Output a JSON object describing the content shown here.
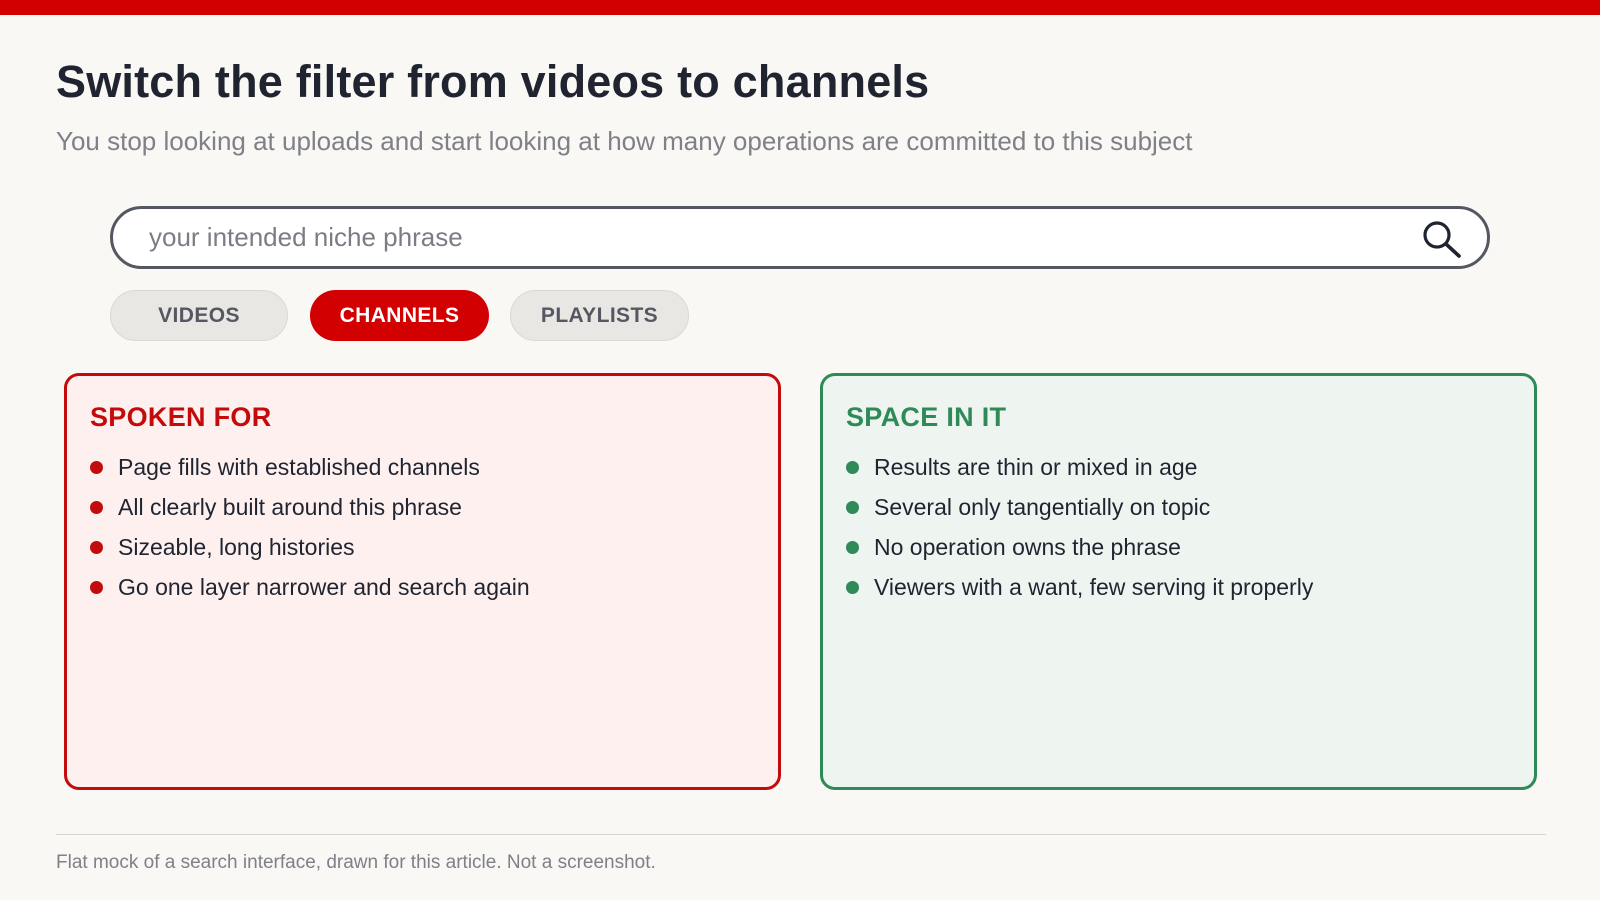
{
  "header": {
    "title": "Switch the filter from videos to channels",
    "subtitle": "You stop looking at uploads and start looking at how many operations are committed to this subject"
  },
  "search": {
    "placeholder": "your intended niche phrase",
    "value": "",
    "icon": "search-icon"
  },
  "filters": {
    "selected": "CHANNELS",
    "items": [
      {
        "label": "VIDEOS",
        "active": false
      },
      {
        "label": "CHANNELS",
        "active": true
      },
      {
        "label": "PLAYLISTS",
        "active": false
      }
    ]
  },
  "panels": {
    "spoken_for": {
      "title": "SPOKEN FOR",
      "items": [
        "Page fills with established channels",
        "All clearly built around this phrase",
        "Sizeable, long histories",
        "Go one layer narrower and search again"
      ]
    },
    "space_in_it": {
      "title": "SPACE IN IT",
      "items": [
        "Results are thin or mixed in age",
        "Several only tangentially on topic",
        "No operation owns the phrase",
        "Viewers with a want, few serving it properly"
      ]
    }
  },
  "footer": {
    "note": "Flat mock of a search interface, drawn for this article. Not a screenshot."
  },
  "colors": {
    "accent": "#d20000",
    "negative": "#c40b0b",
    "positive": "#2e8a57",
    "background": "#f9f8f5"
  }
}
